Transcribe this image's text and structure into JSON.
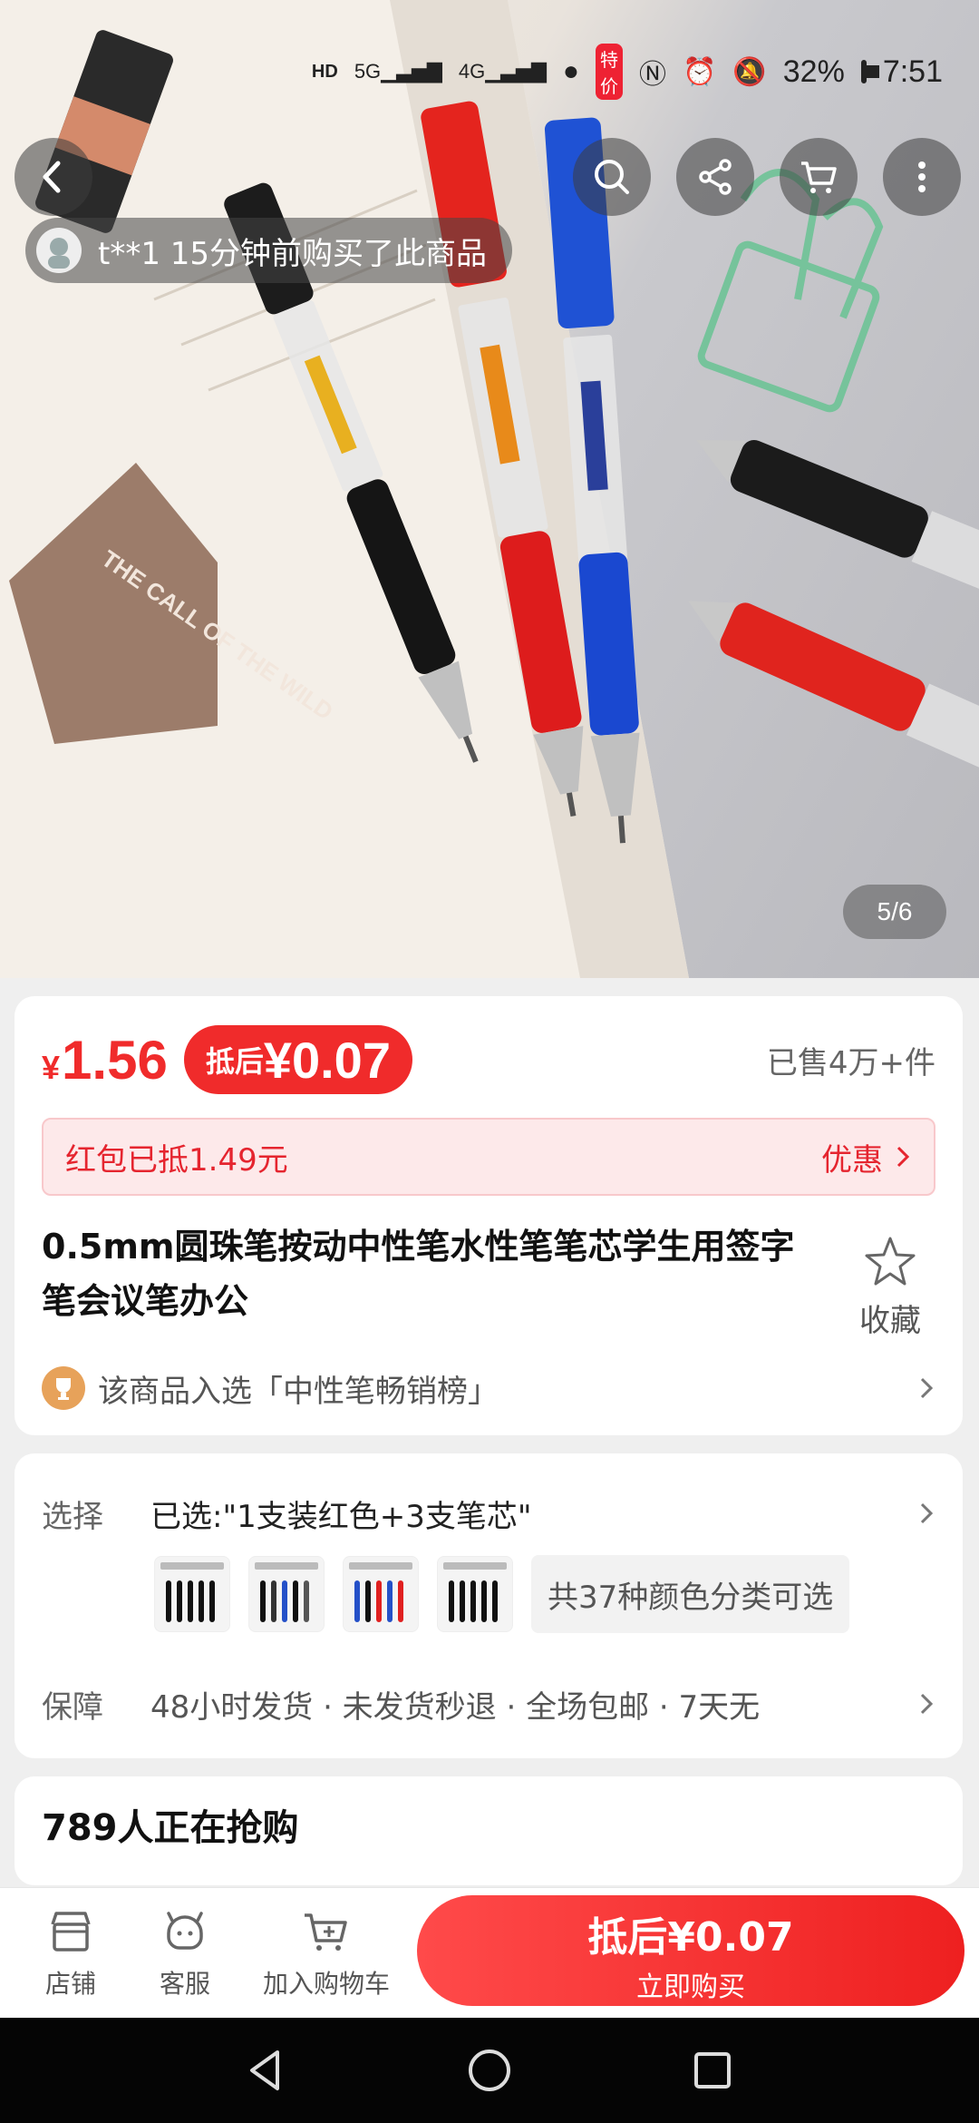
{
  "status_bar": {
    "network1": "5G",
    "network2": "4G",
    "promo_badge": "特价",
    "battery": "32%",
    "time": "7:51"
  },
  "top_buttons": {
    "back": "back-icon",
    "search": "search-icon",
    "share": "share-icon",
    "cart": "cart-icon",
    "more": "more-icon"
  },
  "buyer_toast": "t**1 15分钟前购买了此商品",
  "image_counter": "5/6",
  "hero_card_text": "THE CALL OF THE WILD",
  "price": {
    "currency": "¥",
    "amount": "1.56",
    "deduct_label": "抵后",
    "deduct_amount": "¥0.07",
    "sold": "已售4万+件"
  },
  "coupon": {
    "text": "红包已抵1.49元",
    "action": "优惠"
  },
  "product": {
    "title": "0.5mm圆珠笔按动中性笔水性笔笔芯学生用签字笔会议笔办公",
    "favorite_label": "收藏"
  },
  "ranking": "该商品入选「中性笔畅销榜」",
  "selection": {
    "label": "选择",
    "value": "已选:\"1支装红色+3支笔芯\"",
    "color_count": "共37种颜色分类可选"
  },
  "guarantee": {
    "label": "保障",
    "value": "48小时发货 · 未发货秒退 · 全场包邮 · 7天无"
  },
  "rush": "789人正在抢购",
  "action_bar": {
    "shop": "店铺",
    "service": "客服",
    "add_cart": "加入购物车",
    "buy_line1": "抵后¥0.07",
    "buy_line2": "立即购买"
  },
  "colors": {
    "accent": "#f02b2b",
    "coupon_bg": "#fde9ea"
  }
}
